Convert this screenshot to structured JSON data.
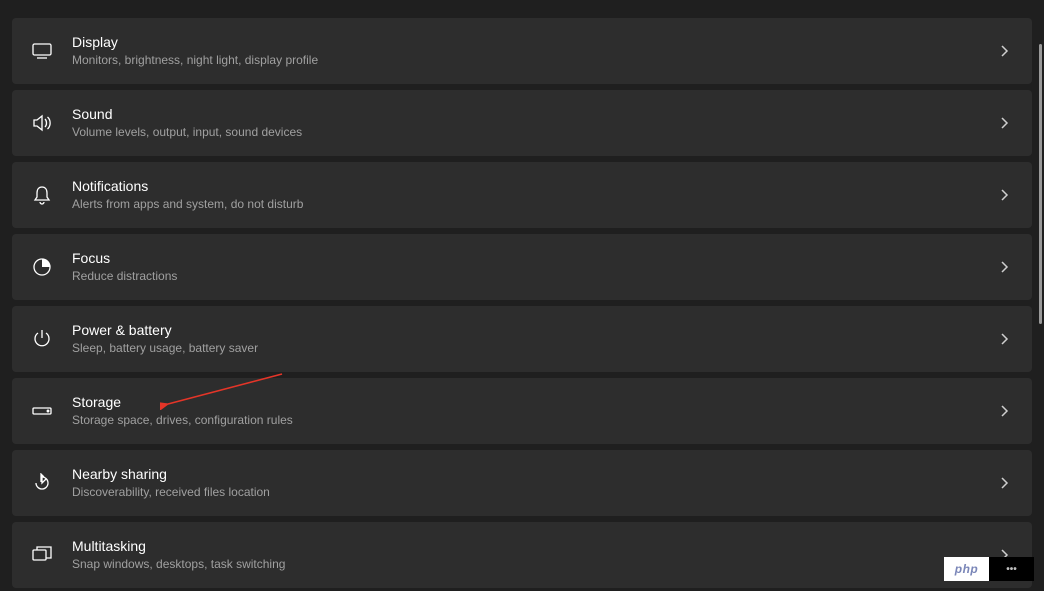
{
  "items": [
    {
      "icon": "display",
      "title": "Display",
      "subtitle": "Monitors, brightness, night light, display profile"
    },
    {
      "icon": "sound",
      "title": "Sound",
      "subtitle": "Volume levels, output, input, sound devices"
    },
    {
      "icon": "bell",
      "title": "Notifications",
      "subtitle": "Alerts from apps and system, do not disturb"
    },
    {
      "icon": "focus",
      "title": "Focus",
      "subtitle": "Reduce distractions"
    },
    {
      "icon": "power",
      "title": "Power & battery",
      "subtitle": "Sleep, battery usage, battery saver"
    },
    {
      "icon": "storage",
      "title": "Storage",
      "subtitle": "Storage space, drives, configuration rules"
    },
    {
      "icon": "share",
      "title": "Nearby sharing",
      "subtitle": "Discoverability, received files location"
    },
    {
      "icon": "multitask",
      "title": "Multitasking",
      "subtitle": "Snap windows, desktops, task switching"
    }
  ],
  "annotation_target_index": 5,
  "badge": {
    "left": "php",
    "right": "•••"
  }
}
